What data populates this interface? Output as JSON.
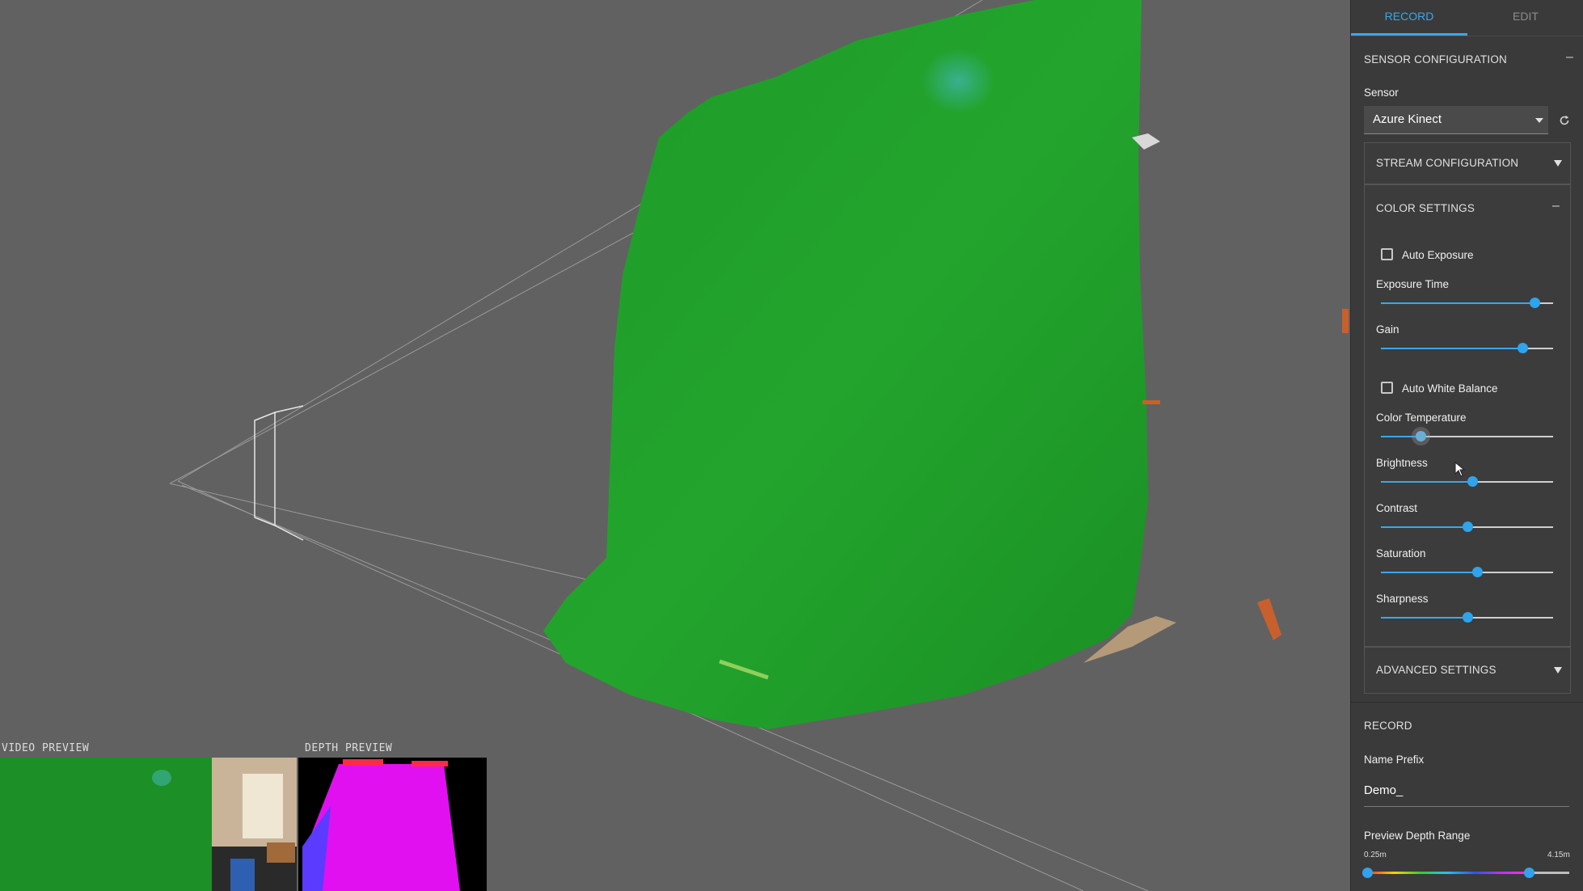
{
  "viewport": {
    "video_preview_label": "VIDEO PREVIEW",
    "depth_preview_label": "DEPTH PREVIEW"
  },
  "tabs": [
    {
      "label": "RECORD",
      "active": true
    },
    {
      "label": "EDIT",
      "active": false
    }
  ],
  "sensor_configuration": {
    "title": "SENSOR CONFIGURATION",
    "collapse_symbol": "–",
    "sensor_label": "Sensor",
    "sensor_value": "Azure Kinect",
    "stream_configuration": "STREAM CONFIGURATION",
    "color_settings": {
      "title": "COLOR SETTINGS",
      "collapse_symbol": "–",
      "auto_exposure": {
        "label": "Auto Exposure",
        "checked": false
      },
      "exposure_time": {
        "label": "Exposure Time",
        "value": 0.89
      },
      "gain": {
        "label": "Gain",
        "value": 0.82
      },
      "auto_white_balance": {
        "label": "Auto White Balance",
        "checked": false
      },
      "color_temperature": {
        "label": "Color Temperature",
        "value": 0.23
      },
      "brightness": {
        "label": "Brightness",
        "value": 0.53
      },
      "contrast": {
        "label": "Contrast",
        "value": 0.5
      },
      "saturation": {
        "label": "Saturation",
        "value": 0.56
      },
      "sharpness": {
        "label": "Sharpness",
        "value": 0.5
      }
    },
    "advanced_settings": "ADVANCED SETTINGS"
  },
  "record": {
    "title": "RECORD",
    "name_prefix_label": "Name Prefix",
    "name_prefix_value": "Demo_",
    "preview_depth_range_label": "Preview Depth Range",
    "range_min": "0.25m",
    "range_max": "4.15m",
    "range_low_value": 0.0,
    "range_high_value": 0.8
  },
  "colors": {
    "accent": "#3aa7ea",
    "panel_bg": "#3a3a3a",
    "viewport_bg": "#616161",
    "greenscreen": "#1f9e2a"
  },
  "icons": {
    "refresh": "refresh-icon",
    "dropdown": "chevron-down-icon",
    "expand": "triangle-down-icon"
  }
}
